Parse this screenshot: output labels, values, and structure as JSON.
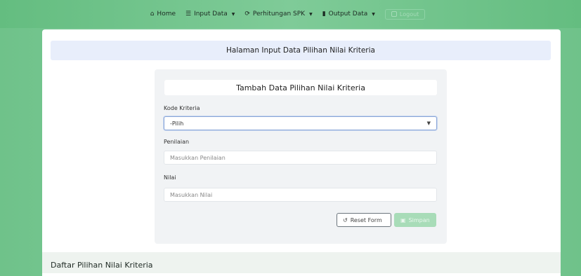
{
  "nav": {
    "home": "Home",
    "input_data": "Input Data",
    "perhitungan_spk": "Perhitungan SPK",
    "output_data": "Output Data",
    "ghost_label": "Logout"
  },
  "page": {
    "header": "Halaman Input Data Pilihan Nilai Kriteria"
  },
  "form": {
    "title": "Tambah Data Pilihan Nilai Kriteria",
    "kode_label": "Kode Kriteria",
    "kode_selected": "-Pilih",
    "penilaian_label": "Penilaian",
    "penilaian_placeholder": "Masukkan Penilaian",
    "nilai_label": "Nilai",
    "nilai_placeholder": "Masukkan Nilai",
    "reset_label": "Reset Form",
    "save_label": "Simpan"
  },
  "list": {
    "title": "Daftar Pilihan Nilai Kriteria"
  },
  "colors": {
    "accent_green": "#6fc28a",
    "header_blue": "#e8eefb",
    "save_disabled": "#a8dcb8"
  }
}
